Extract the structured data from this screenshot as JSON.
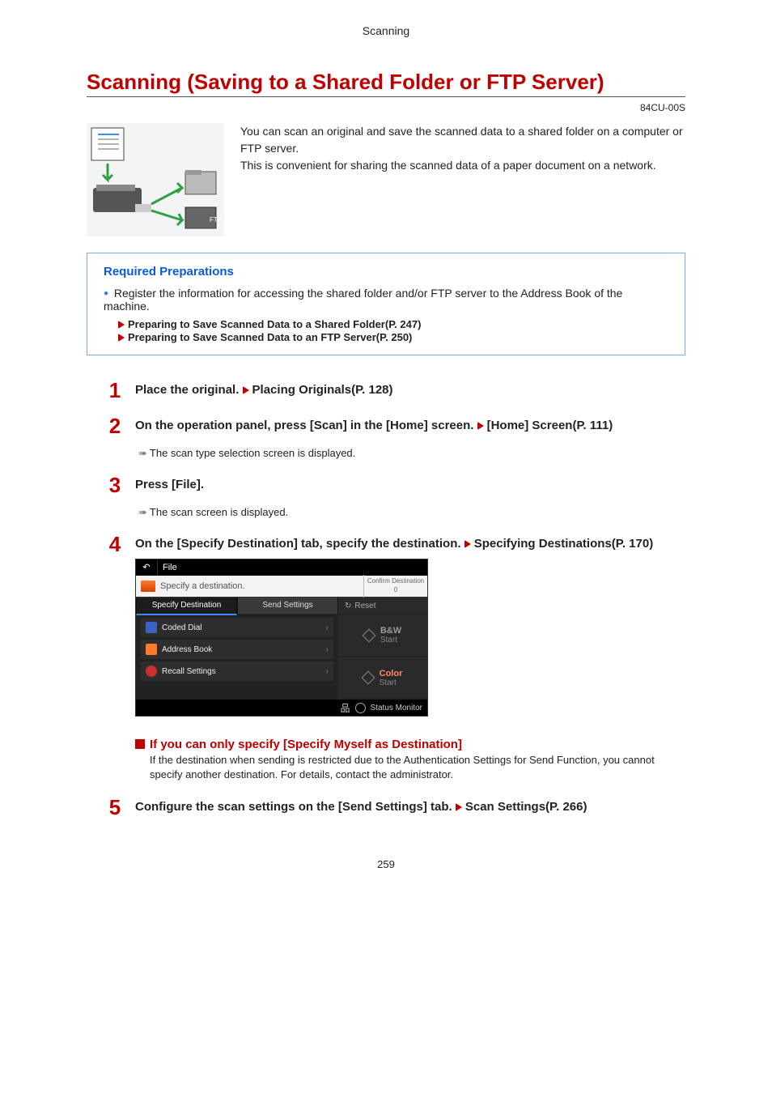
{
  "header": {
    "section": "Scanning"
  },
  "title": "Scanning (Saving to a Shared Folder or FTP Server)",
  "doc_id": "84CU-00S",
  "intro": {
    "p1": "You can scan an original and save the scanned data to a shared folder on a computer or FTP server.",
    "p2": "This is convenient for sharing the scanned data of a paper document on a network."
  },
  "prep": {
    "title": "Required Preparations",
    "item": "Register the information for accessing the shared folder and/or FTP server to the Address Book of the machine.",
    "link1": "Preparing to Save Scanned Data to a Shared Folder(P. 247)",
    "link2": "Preparing to Save Scanned Data to an FTP Server(P. 250)"
  },
  "steps": {
    "s1": {
      "text": "Place the original. ",
      "link": "Placing Originals(P. 128)"
    },
    "s2": {
      "text": "On the operation panel, press [Scan] in the [Home] screen. ",
      "link": "[Home] Screen(P. 111)",
      "sub": "The scan type selection screen is displayed."
    },
    "s3": {
      "text": "Press [File].",
      "sub": "The scan screen is displayed."
    },
    "s4": {
      "text": "On the [Specify Destination] tab, specify the destination. ",
      "link": "Specifying Destinations(P. 170)"
    },
    "s5": {
      "text": "Configure the scan settings on the [Send Settings] tab. ",
      "link": "Scan Settings(P. 266)"
    }
  },
  "screenshot": {
    "title": "File",
    "dest_prompt": "Specify a destination.",
    "confirm": "Confirm Destination",
    "confirm_count": "0",
    "tab1": "Specify Destination",
    "tab2": "Send Settings",
    "items": [
      {
        "label": "Coded Dial",
        "icon_bg": "#3b63c4"
      },
      {
        "label": "Address Book",
        "icon_bg": "#ff7a2a"
      },
      {
        "label": "Recall Settings",
        "icon_bg": "#c83232"
      }
    ],
    "reset": "Reset",
    "start_bw_title": "B&W",
    "start_bw_sub": "Start",
    "start_color_title": "Color",
    "start_color_sub": "Start",
    "status": "Status Monitor"
  },
  "note": {
    "title": "If you can only specify [Specify Myself as Destination]",
    "body": "If the destination when sending is restricted due to the Authentication Settings for Send Function, you cannot specify another destination. For details, contact the administrator."
  },
  "page_number": "259"
}
